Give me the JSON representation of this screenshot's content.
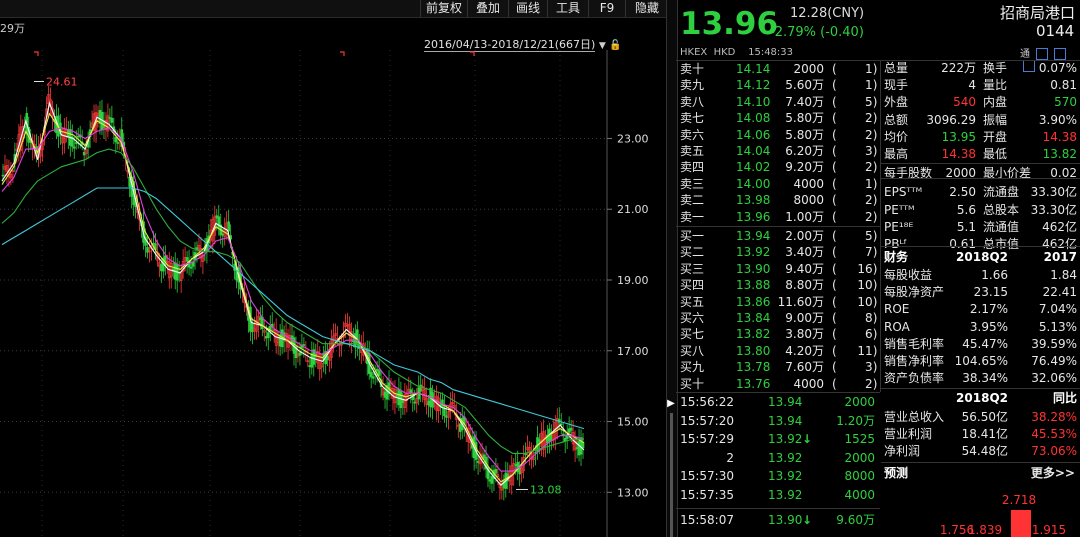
{
  "toolbar": {
    "buttons": [
      "前复权",
      "叠加",
      "画线",
      "工具",
      "F9",
      "隐藏"
    ]
  },
  "chart_panel": {
    "volume_label": "29万",
    "date_range": "2016/04/13-2018/12/21(667日)",
    "high_label": "24.61",
    "low_label": "13.08",
    "y_ticks": [
      "23.00",
      "21.00",
      "19.00",
      "17.00",
      "15.00",
      "13.00"
    ]
  },
  "chart_data": {
    "type": "line",
    "y_axis_ticks": [
      23.0,
      21.0,
      19.0,
      17.0,
      15.0,
      13.0
    ],
    "ylim": [
      12.5,
      25.5
    ],
    "period_high": 24.61,
    "period_low": 13.08,
    "series": [
      {
        "color": "#ffffff",
        "values": [
          21.8,
          22.3,
          23.5,
          22.4,
          24.0,
          23.1,
          23.0,
          22.7,
          23.6,
          23.4,
          23.0,
          21.6,
          20.2,
          19.7,
          19.3,
          19.2,
          19.6,
          19.8,
          20.6,
          20.4,
          19.0,
          17.8,
          17.7,
          17.4,
          17.3,
          17.0,
          16.8,
          16.7,
          17.2,
          17.6,
          17.3,
          16.6,
          16.0,
          15.7,
          15.6,
          15.8,
          15.7,
          15.4,
          15.3,
          14.8,
          14.1,
          13.6,
          13.2,
          13.5,
          13.9,
          14.3,
          14.6,
          14.9,
          14.5,
          14.2
        ]
      },
      {
        "color": "#e8e84a",
        "values": [
          21.7,
          22.2,
          23.2,
          22.6,
          23.7,
          23.2,
          23.1,
          22.8,
          23.5,
          23.3,
          22.9,
          21.8,
          20.4,
          19.8,
          19.4,
          19.3,
          19.6,
          19.9,
          20.5,
          20.3,
          19.1,
          17.9,
          17.7,
          17.5,
          17.3,
          17.1,
          16.9,
          16.8,
          17.2,
          17.5,
          17.3,
          16.7,
          16.1,
          15.8,
          15.7,
          15.8,
          15.7,
          15.5,
          15.3,
          14.9,
          14.2,
          13.7,
          13.3,
          13.5,
          13.9,
          14.3,
          14.6,
          14.8,
          14.6,
          14.4
        ]
      },
      {
        "color": "#e040e0",
        "values": [
          21.5,
          21.9,
          22.7,
          22.7,
          23.2,
          23.3,
          23.2,
          23.0,
          23.2,
          23.3,
          23.0,
          22.1,
          20.9,
          20.1,
          19.6,
          19.4,
          19.5,
          19.7,
          20.1,
          20.2,
          19.4,
          18.4,
          17.9,
          17.6,
          17.4,
          17.2,
          17.0,
          16.9,
          17.1,
          17.3,
          17.3,
          16.9,
          16.4,
          16.0,
          15.8,
          15.8,
          15.7,
          15.5,
          15.4,
          15.1,
          14.5,
          14.0,
          13.6,
          13.6,
          13.8,
          14.1,
          14.4,
          14.6,
          14.6,
          14.5
        ]
      },
      {
        "color": "#2eae3a",
        "values": [
          20.6,
          20.9,
          21.4,
          21.8,
          22.0,
          22.2,
          22.3,
          22.4,
          22.6,
          22.7,
          22.6,
          22.2,
          21.6,
          21.0,
          20.5,
          20.1,
          19.9,
          19.8,
          19.8,
          19.7,
          19.5,
          19.0,
          18.5,
          18.1,
          17.8,
          17.6,
          17.4,
          17.2,
          17.2,
          17.2,
          17.2,
          17.0,
          16.7,
          16.4,
          16.2,
          16.0,
          15.9,
          15.8,
          15.6,
          15.4,
          15.0,
          14.6,
          14.3,
          14.1,
          14.1,
          14.2,
          14.3,
          14.4,
          14.5,
          14.5
        ]
      },
      {
        "color": "#40c8d8",
        "values": [
          20.0,
          20.2,
          20.4,
          20.6,
          20.8,
          21.0,
          21.2,
          21.4,
          21.6,
          21.6,
          21.6,
          21.6,
          21.5,
          21.3,
          21.0,
          20.7,
          20.4,
          20.1,
          19.8,
          19.5,
          19.2,
          18.9,
          18.6,
          18.3,
          18.0,
          17.8,
          17.6,
          17.4,
          17.3,
          17.2,
          17.1,
          17.0,
          16.8,
          16.6,
          16.5,
          16.4,
          16.2,
          16.1,
          15.9,
          15.8,
          15.7,
          15.6,
          15.5,
          15.4,
          15.3,
          15.2,
          15.1,
          15.0,
          14.9,
          14.8
        ]
      }
    ]
  },
  "quote": {
    "price": "13.96",
    "prev_close": "12.28(CNY)",
    "change": "-2.79% (-0.40)",
    "name": "招商局港口",
    "code": "0144",
    "exchange": "HKEX  HKD    15:48:33",
    "icon_tong": "通"
  },
  "orderbook": {
    "asks": [
      {
        "label": "卖十",
        "price": "14.14",
        "vol": "2000",
        "n": "1"
      },
      {
        "label": "卖九",
        "price": "14.12",
        "vol": "5.60万",
        "n": "1"
      },
      {
        "label": "卖八",
        "price": "14.10",
        "vol": "7.40万",
        "n": "5"
      },
      {
        "label": "卖七",
        "price": "14.08",
        "vol": "5.80万",
        "n": "2"
      },
      {
        "label": "卖六",
        "price": "14.06",
        "vol": "5.80万",
        "n": "2"
      },
      {
        "label": "卖五",
        "price": "14.04",
        "vol": "6.20万",
        "n": "3"
      },
      {
        "label": "卖四",
        "price": "14.02",
        "vol": "9.20万",
        "n": "2"
      },
      {
        "label": "卖三",
        "price": "14.00",
        "vol": "4000",
        "n": "1"
      },
      {
        "label": "卖二",
        "price": "13.98",
        "vol": "8000",
        "n": "2"
      },
      {
        "label": "卖一",
        "price": "13.96",
        "vol": "1.00万",
        "n": "2"
      }
    ],
    "bids": [
      {
        "label": "买一",
        "price": "13.94",
        "vol": "2.00万",
        "n": "5"
      },
      {
        "label": "买二",
        "price": "13.92",
        "vol": "3.40万",
        "n": "7"
      },
      {
        "label": "买三",
        "price": "13.90",
        "vol": "9.40万",
        "n": "16"
      },
      {
        "label": "买四",
        "price": "13.88",
        "vol": "8.80万",
        "n": "10"
      },
      {
        "label": "买五",
        "price": "13.86",
        "vol": "11.60万",
        "n": "10"
      },
      {
        "label": "买六",
        "price": "13.84",
        "vol": "9.00万",
        "n": "8"
      },
      {
        "label": "买七",
        "price": "13.82",
        "vol": "3.80万",
        "n": "6"
      },
      {
        "label": "买八",
        "price": "13.80",
        "vol": "4.20万",
        "n": "11"
      },
      {
        "label": "买九",
        "price": "13.78",
        "vol": "7.60万",
        "n": "3"
      },
      {
        "label": "买十",
        "price": "13.76",
        "vol": "4000",
        "n": "2"
      }
    ]
  },
  "stats": [
    {
      "k1": "总量",
      "v1": "222万",
      "c1": "white",
      "k2": "换手",
      "v2": "0.07%",
      "c2": "white"
    },
    {
      "k1": "现手",
      "v1": "4",
      "c1": "white",
      "k2": "量比",
      "v2": "0.81",
      "c2": "white"
    },
    {
      "k1": "外盘",
      "v1": "540",
      "c1": "red",
      "k2": "内盘",
      "v2": "570",
      "c2": "green"
    },
    {
      "k1": "总额",
      "v1": "3096.29",
      "c1": "white",
      "k2": "振幅",
      "v2": "3.90%",
      "c2": "white"
    },
    {
      "k1": "均价",
      "v1": "13.95",
      "c1": "green",
      "k2": "开盘",
      "v2": "14.38",
      "c2": "red"
    },
    {
      "k1": "最高",
      "v1": "14.38",
      "c1": "red",
      "k2": "最低",
      "v2": "13.82",
      "c2": "green"
    },
    {
      "k1": "每手股数",
      "v1": "2000",
      "c1": "white",
      "k2": "最小价差",
      "v2": "0.02",
      "c2": "white"
    },
    {
      "k1": "EPSᵀᵀᴹ",
      "v1": "2.50",
      "c1": "white",
      "k2": "流通盘",
      "v2": "33.30亿",
      "c2": "white"
    },
    {
      "k1": "PEᵀᵀᴹ",
      "v1": "5.6",
      "c1": "white",
      "k2": "总股本",
      "v2": "33.30亿",
      "c2": "white"
    },
    {
      "k1": "PE¹⁸ᴱ",
      "v1": "5.1",
      "c1": "white",
      "k2": "流通值",
      "v2": "462亿",
      "c2": "white"
    },
    {
      "k1": "PBᴸᶠ",
      "v1": "0.61",
      "c1": "white",
      "k2": "总市值",
      "v2": "462亿",
      "c2": "white"
    }
  ],
  "financials": {
    "header": [
      "财务",
      "2018Q2",
      "2017"
    ],
    "rows": [
      {
        "k": "每股收益",
        "a": "1.66",
        "ca": "white",
        "b": "1.84",
        "cb": "white"
      },
      {
        "k": "每股净资产",
        "a": "23.15",
        "ca": "white",
        "b": "22.41",
        "cb": "white"
      },
      {
        "k": "ROE",
        "a": "2.17%",
        "ca": "white",
        "b": "7.04%",
        "cb": "white"
      },
      {
        "k": "ROA",
        "a": "3.95%",
        "ca": "white",
        "b": "5.13%",
        "cb": "white"
      },
      {
        "k": "销售毛利率",
        "a": "45.47%",
        "ca": "white",
        "b": "39.59%",
        "cb": "white"
      },
      {
        "k": "销售净利率",
        "a": "104.65%",
        "ca": "white",
        "b": "76.49%",
        "cb": "white"
      },
      {
        "k": "资产负债率",
        "a": "38.34%",
        "ca": "white",
        "b": "32.06%",
        "cb": "white"
      }
    ],
    "header2": [
      "2018Q2",
      "同比"
    ],
    "rows2": [
      {
        "k": "营业总收入",
        "a": "56.50亿",
        "b": "38.28%"
      },
      {
        "k": "营业利润",
        "a": "18.41亿",
        "b": "45.53%"
      },
      {
        "k": "净利润",
        "a": "54.48亿",
        "b": "73.06%"
      }
    ],
    "forecast_label": "预测",
    "more_label": "更多>>",
    "forecast_bars": [
      {
        "label": "1.756",
        "value": 1.756,
        "color": "#ff3333",
        "highlight": false
      },
      {
        "label": "1.839",
        "value": 1.839,
        "color": "#ff3333",
        "highlight": false
      },
      {
        "label": "2.718",
        "value": 2.718,
        "color": "#ff3333",
        "highlight": true
      },
      {
        "label": "1.915",
        "value": 1.915,
        "color": "#ff3333",
        "highlight": false
      }
    ]
  },
  "ticks": [
    {
      "time": "15:56:22",
      "price": "13.94",
      "vol": "2000",
      "arrow": ""
    },
    {
      "time": "15:57:20",
      "price": "13.94",
      "vol": "1.20万",
      "arrow": ""
    },
    {
      "time": "15:57:29",
      "price": "13.92",
      "vol": "1525",
      "arrow": "↓"
    },
    {
      "time": "2",
      "price": "13.92",
      "vol": "2000",
      "arrow": ""
    },
    {
      "time": "15:57:30",
      "price": "13.92",
      "vol": "8000",
      "arrow": ""
    },
    {
      "time": "15:57:35",
      "price": "13.92",
      "vol": "4000",
      "arrow": ""
    },
    {
      "time": "15:58:07",
      "price": "13.90",
      "vol": "9.60万",
      "arrow": "↓"
    }
  ]
}
